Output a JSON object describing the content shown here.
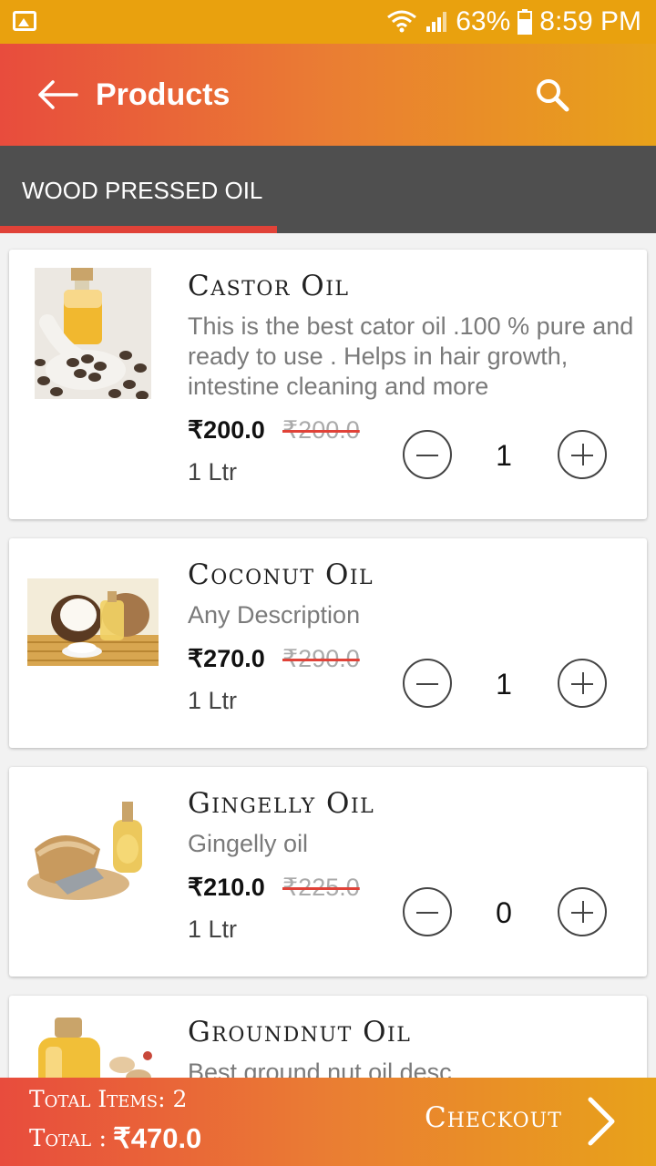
{
  "status_bar": {
    "battery": "63%",
    "time": "8:59 PM"
  },
  "app_bar": {
    "title": "Products"
  },
  "tabs": [
    {
      "label": "WOOD PRESSED OIL"
    }
  ],
  "products": [
    {
      "name": "Castor Oil",
      "description": "This is the best cator oil .100 % pure and ready to use . Helps in hair growth, intestine cleaning and more",
      "price": "₹200.0",
      "mrp": "₹200.0",
      "unit": "1 Ltr",
      "quantity": "1"
    },
    {
      "name": "Coconut Oil",
      "description": "Any Description",
      "price": "₹270.0",
      "mrp": "₹290.0",
      "unit": "1 Ltr",
      "quantity": "1"
    },
    {
      "name": "Gingelly Oil",
      "description": "Gingelly oil",
      "price": "₹210.0",
      "mrp": "₹225.0",
      "unit": "1 Ltr",
      "quantity": "0"
    },
    {
      "name": "Groundnut Oil",
      "description": "Best ground nut oil desc",
      "price": "",
      "mrp": "",
      "unit": "",
      "quantity": ""
    }
  ],
  "footer": {
    "total_items_label": "Total Items: 2",
    "total_label": "Total :",
    "total_value": "₹470.0",
    "checkout_label": "Checkout"
  },
  "colors": {
    "status_bar": "#e9a10e",
    "gradient_start": "#e84c3d",
    "gradient_end": "#e8a21a",
    "tab_bar": "#4f4f4f",
    "tab_indicator": "#e04238",
    "strike": "#e04238"
  },
  "icons": {
    "back": "arrow-left-icon",
    "search": "search-icon",
    "minus": "minus-circle-icon",
    "plus": "plus-circle-icon",
    "checkout": "chevron-right-icon"
  }
}
